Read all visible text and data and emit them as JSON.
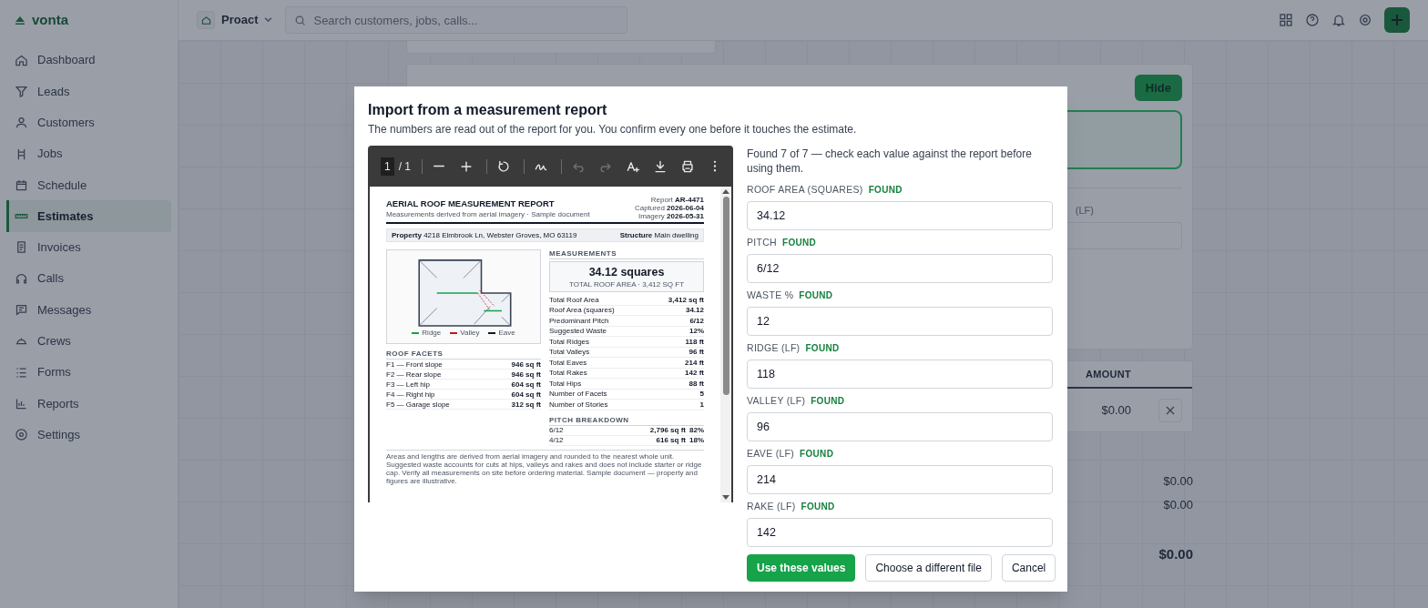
{
  "app": {
    "logo": "vonta"
  },
  "topbar": {
    "workspace": "Proact",
    "search_placeholder": "Search customers, jobs, calls..."
  },
  "sidebar": {
    "items": [
      {
        "label": "Dashboard",
        "selected": false
      },
      {
        "label": "Leads",
        "selected": false
      },
      {
        "label": "Customers",
        "selected": false
      },
      {
        "label": "Jobs",
        "selected": false
      },
      {
        "label": "Schedule",
        "selected": false
      },
      {
        "label": "Estimates",
        "selected": true
      },
      {
        "label": "Invoices",
        "selected": false
      },
      {
        "label": "Calls",
        "selected": false
      },
      {
        "label": "Messages",
        "selected": false
      },
      {
        "label": "Crews",
        "selected": false
      },
      {
        "label": "Forms",
        "selected": false
      },
      {
        "label": "Reports",
        "selected": false
      },
      {
        "label": "Settings",
        "selected": false
      }
    ]
  },
  "background": {
    "hide_button": "Hide",
    "field_label": "(LF)",
    "table_header": "AMOUNT",
    "row_amount": "$0.00",
    "totals": [
      "$0.00",
      "$0.00",
      "$0.00"
    ]
  },
  "modal": {
    "title": "Import from a measurement report",
    "subtitle": "The numbers are read out of the report for you. You confirm every one before it touches the estimate.",
    "viewer": {
      "page_current": "1",
      "page_total": "/ 1",
      "tools": [
        {
          "disabled": false
        },
        {
          "disabled": false
        },
        {
          "disabled": false
        },
        {
          "disabled": false
        },
        {
          "disabled": true
        },
        {
          "disabled": true
        },
        {
          "disabled": false
        },
        {
          "disabled": false
        },
        {
          "disabled": false
        },
        {
          "disabled": false
        }
      ],
      "report": {
        "title": "AERIAL ROOF MEASUREMENT REPORT",
        "subtitle": "Measurements derived from aerial imagery · Sample document",
        "meta": [
          {
            "label": "Report",
            "value": "AR-4471"
          },
          {
            "label": "Captured",
            "value": "2026-06-04"
          },
          {
            "label": "Imagery",
            "value": "2026-05-31"
          }
        ],
        "property_label": "Property",
        "property": "4218 Elmbrook Ln, Webster Groves, MO 63119",
        "structure_label": "Structure",
        "structure": "Main dwelling",
        "legend": [
          {
            "label": "Ridge",
            "color": "#16a34a"
          },
          {
            "label": "Valley",
            "color": "#b91c1c"
          },
          {
            "label": "Eave",
            "color": "#111827"
          }
        ],
        "facets_heading": "ROOF FACETS",
        "facets": [
          {
            "name": "F1 — Front slope",
            "area": "946 sq ft"
          },
          {
            "name": "F2 — Rear slope",
            "area": "946 sq ft"
          },
          {
            "name": "F3 — Left hip",
            "area": "604 sq ft"
          },
          {
            "name": "F4 — Right hip",
            "area": "604 sq ft"
          },
          {
            "name": "F5 — Garage slope",
            "area": "312 sq ft"
          }
        ],
        "measurements_heading": "MEASUREMENTS",
        "headline": "34.12 squares",
        "headline_sub": "TOTAL ROOF AREA · 3,412 SQ FT",
        "measurements": [
          {
            "label": "Total Roof Area",
            "value": "3,412 sq ft"
          },
          {
            "label": "Roof Area (squares)",
            "value": "34.12"
          },
          {
            "label": "Predominant Pitch",
            "value": "6/12"
          },
          {
            "label": "Suggested Waste",
            "value": "12%"
          },
          {
            "label": "Total Ridges",
            "value": "118 ft"
          },
          {
            "label": "Total Valleys",
            "value": "96 ft"
          },
          {
            "label": "Total Eaves",
            "value": "214 ft"
          },
          {
            "label": "Total Rakes",
            "value": "142 ft"
          },
          {
            "label": "Total Hips",
            "value": "88 ft"
          },
          {
            "label": "Number of Facets",
            "value": "5"
          },
          {
            "label": "Number of Stories",
            "value": "1"
          }
        ],
        "pitch_heading": "PITCH BREAKDOWN",
        "pitches": [
          {
            "pitch": "6/12",
            "area": "2,796 sq ft",
            "share": "82%"
          },
          {
            "pitch": "4/12",
            "area": "616 sq ft",
            "share": "18%"
          }
        ],
        "footnote": "Areas and lengths are derived from aerial imagery and rounded to the nearest whole unit. Suggested waste accounts for cuts at hips, valleys and rakes and does not include starter or ridge cap. Verify all measurements on site before ordering material. Sample document — property and figures are illustrative."
      }
    },
    "summary": "Found 7 of 7 — check each value against the report before using them.",
    "fields": [
      {
        "label": "ROOF AREA (SQUARES)",
        "status": "FOUND",
        "value": "34.12"
      },
      {
        "label": "PITCH",
        "status": "FOUND",
        "value": "6/12"
      },
      {
        "label": "WASTE %",
        "status": "FOUND",
        "value": "12"
      },
      {
        "label": "RIDGE (LF)",
        "status": "FOUND",
        "value": "118"
      },
      {
        "label": "VALLEY (LF)",
        "status": "FOUND",
        "value": "96"
      },
      {
        "label": "EAVE (LF)",
        "status": "FOUND",
        "value": "214"
      },
      {
        "label": "RAKE (LF)",
        "status": "FOUND",
        "value": "142"
      }
    ],
    "buttons": [
      {
        "label": "Use these values",
        "kind": "primary"
      },
      {
        "label": "Choose a different file",
        "kind": "secondary"
      },
      {
        "label": "Cancel",
        "kind": "secondary"
      }
    ]
  }
}
